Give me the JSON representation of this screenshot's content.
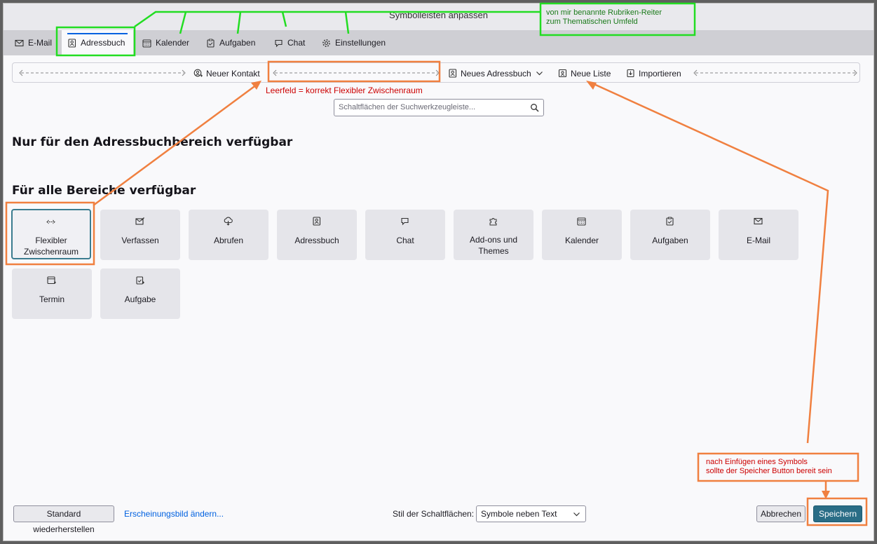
{
  "window": {
    "title": "Symbolleisten anpassen"
  },
  "tabs": [
    {
      "label": "E-Mail",
      "icon": "mail-icon"
    },
    {
      "label": "Adressbuch",
      "icon": "addressbook-icon"
    },
    {
      "label": "Kalender",
      "icon": "calendar-icon"
    },
    {
      "label": "Aufgaben",
      "icon": "tasks-icon"
    },
    {
      "label": "Chat",
      "icon": "chat-icon"
    },
    {
      "label": "Einstellungen",
      "icon": "gear-icon"
    }
  ],
  "toolbar": {
    "new_contact": "Neuer Kontakt",
    "new_addressbook": "Neues Adressbuch",
    "new_list": "Neue Liste",
    "import": "Importieren"
  },
  "search": {
    "placeholder": "Schaltflächen der Suchwerkzeugleiste..."
  },
  "sections": {
    "addressbook_only": "Nur für den Adressbuchbereich verfügbar",
    "all_areas": "Für alle Bereiche verfügbar"
  },
  "palette": [
    {
      "label": "Flexibler Zwischenraum",
      "icon": "flexible-space-icon"
    },
    {
      "label": "Verfassen",
      "icon": "compose-icon"
    },
    {
      "label": "Abrufen",
      "icon": "get-messages-icon"
    },
    {
      "label": "Adressbuch",
      "icon": "addressbook-icon"
    },
    {
      "label": "Chat",
      "icon": "chat-icon"
    },
    {
      "label": "Add-ons und Themes",
      "icon": "puzzle-icon"
    },
    {
      "label": "Kalender",
      "icon": "calendar-icon"
    },
    {
      "label": "Aufgaben",
      "icon": "tasks-icon"
    },
    {
      "label": "E-Mail",
      "icon": "mail-icon"
    },
    {
      "label": "Termin",
      "icon": "event-icon"
    },
    {
      "label": "Aufgabe",
      "icon": "task-icon"
    }
  ],
  "footer": {
    "restore": "Standard wiederherstellen",
    "appearance": "Erscheinungsbild ändern...",
    "style_label": "Stil der Schaltflächen:",
    "style_value": "Symbole neben Text",
    "cancel": "Abbrechen",
    "save": "Speichern"
  },
  "annotations": {
    "tabs_note_line1": "von mir benannte Rubriken-Reiter",
    "tabs_note_line2": "zum Thematischen Umfeld",
    "spacer_note": "Leerfeld = korrekt Flexibler Zwischenraum",
    "save_note_line1": "nach Einfügen eines Symbols",
    "save_note_line2": "sollte der Speicher Button bereit sein"
  },
  "colors": {
    "accent": "#0061e0",
    "save_button": "#2a6d86",
    "annotation_green": "#22dd22",
    "annotation_orange": "#f08040",
    "annotation_text_red": "#cc0000"
  }
}
